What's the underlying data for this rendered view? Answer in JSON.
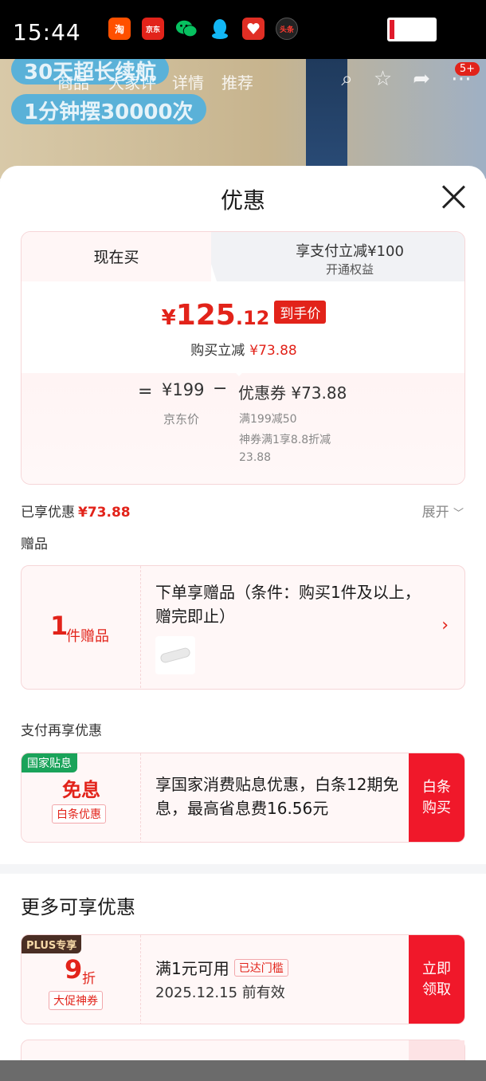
{
  "status_bar": {
    "time": "15:44",
    "apps": [
      {
        "name": "taobao-icon",
        "label": "淘",
        "color": "#ff5000"
      },
      {
        "name": "jd-icon",
        "label": "京东",
        "color": "#e2231a"
      },
      {
        "name": "wechat-icon",
        "label": "",
        "color": "#07c160"
      },
      {
        "name": "qq-icon",
        "label": "",
        "color": "#12b7f5"
      },
      {
        "name": "pinduoduo-icon",
        "label": "",
        "color": "#e02e24"
      },
      {
        "name": "toutiao-icon",
        "label": "头条",
        "color": "#222222"
      }
    ]
  },
  "background_page": {
    "promo_line1": "30天超长续航",
    "promo_line2": "1分钟摆30000次",
    "tabs": [
      "商品",
      "大家评",
      "详情",
      "推荐"
    ],
    "cart_badge": "5+"
  },
  "sheet": {
    "title": "优惠",
    "tabs": {
      "now_buy": "现在买",
      "pay_reduce": "享支付立减¥100",
      "pay_reduce_sub": "开通权益"
    },
    "final_price": {
      "currency": "¥",
      "integer": "125",
      "decimal": ".12",
      "tag": "到手价"
    },
    "instant_reduce": {
      "label": "购买立减",
      "amount": "¥73.88"
    },
    "breakdown": {
      "equals": "=",
      "jd_price": "¥199",
      "jd_price_label": "京东价",
      "minus": "−",
      "coupon": "优惠券 ¥73.88",
      "coupon_detail_1": "满199减50",
      "coupon_detail_2": "神券满1享8.8折减23.88"
    },
    "enjoyed": {
      "label": "已享优惠",
      "amount": "¥73.88",
      "expand": "展开"
    },
    "gift_section": {
      "label": "赠品",
      "count": "1",
      "unit": "件赠品",
      "text": "下单享赠品（条件：购买1件及以上，赠完即止）"
    },
    "pay_section": {
      "label": "支付再享优惠",
      "badge": "国家贴息",
      "title": "免息",
      "sub": "白条优惠",
      "text": "享国家消费贴息优惠，白条12期免息，最高省息费16.56元",
      "button": "白条购买"
    },
    "more_section": {
      "title": "更多可享优惠",
      "coupon": {
        "badge": "PLUS专享",
        "discount": "9",
        "unit": "折",
        "sub": "大促神券",
        "condition": "满1元可用",
        "met_tag": "已达门槛",
        "expiry": "2025.12.15 前有效",
        "button": "立即领取"
      }
    }
  }
}
